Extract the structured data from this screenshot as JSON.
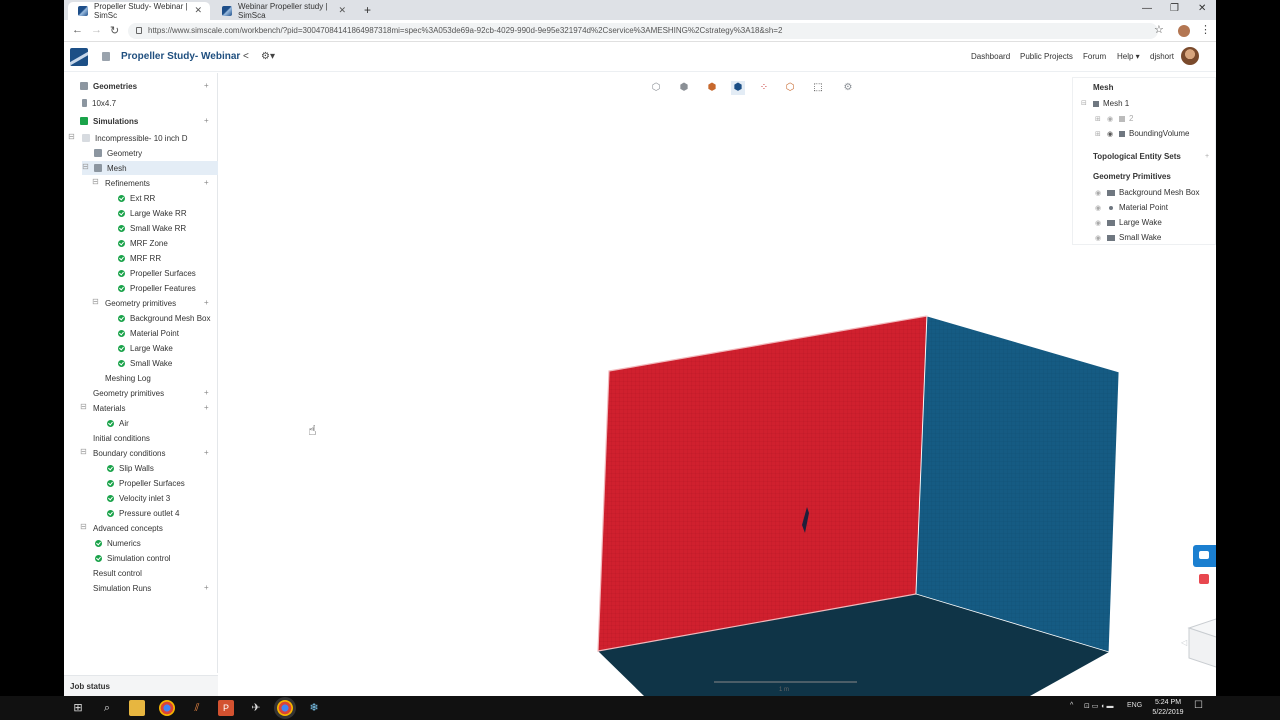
{
  "browser": {
    "tabs": [
      {
        "title": "Propeller Study- Webinar | SimSc",
        "active": true
      },
      {
        "title": "Webinar Propeller study | SimSca",
        "active": false
      }
    ],
    "url": "https://www.simscale.com/workbench/?pid=30047084141864987318mi=spec%3A053de69a-92cb-4029-990d-9e95e321974d%2Cservice%3AMESHING%2Cstrategy%3A18&sh=2",
    "window_controls": [
      "—",
      "❐",
      "✕"
    ]
  },
  "app": {
    "project_title": "Propeller Study- Webinar",
    "nav": [
      "Dashboard",
      "Public Projects",
      "Forum",
      "Help ▾",
      "djshort"
    ]
  },
  "tree": {
    "geometries_header": "Geometries",
    "geometry_item": "10x4.7",
    "simulations_header": "Simulations",
    "simulation": "Incompressible- 10 inch D",
    "geometry": "Geometry",
    "mesh": "Mesh",
    "refinements": "Refinements",
    "refinement_items": [
      "Ext RR",
      "Large Wake RR",
      "Small Wake RR",
      "MRF Zone",
      "MRF RR",
      "Propeller Surfaces",
      "Propeller Features"
    ],
    "mesh_geom_primitives": "Geometry primitives",
    "mesh_geom_items": [
      "Background Mesh Box",
      "Material Point",
      "Large Wake",
      "Small Wake"
    ],
    "meshing_log": "Meshing Log",
    "geometry_primitives": "Geometry primitives",
    "materials": "Materials",
    "material_items": [
      "Air"
    ],
    "initial_conditions": "Initial conditions",
    "boundary_conditions": "Boundary conditions",
    "bc_items": [
      "Slip Walls",
      "Propeller Surfaces",
      "Velocity inlet 3",
      "Pressure outlet 4"
    ],
    "advanced_concepts": "Advanced concepts",
    "advanced_items": [
      "Numerics",
      "Simulation control"
    ],
    "result_control": "Result control",
    "simulation_runs": "Simulation Runs",
    "job_status": "Job status"
  },
  "viewer": {
    "toolbar_icons": [
      "cube-outline-icon",
      "cube-solid-icon",
      "cube-orange-icon",
      "cube-selected-icon",
      "cube-points-icon",
      "cube-wire-icon",
      "box-select-icon",
      "settings-icon"
    ],
    "scale_label": "1 m",
    "colors": {
      "front_face": "#d0202e",
      "side_face": "#155b83",
      "bottom_face": "#0f3447"
    }
  },
  "right_panel": {
    "mesh_header": "Mesh",
    "mesh_item": "Mesh 1",
    "mesh_children": [
      "2",
      "BoundingVolume"
    ],
    "topological_header": "Topological Entity Sets",
    "primitives_header": "Geometry Primitives",
    "primitives": [
      "Background Mesh Box",
      "Material Point",
      "Large Wake",
      "Small Wake"
    ]
  },
  "taskbar": {
    "language": "ENG",
    "time": "5:24 PM",
    "date": "5/22/2019"
  }
}
